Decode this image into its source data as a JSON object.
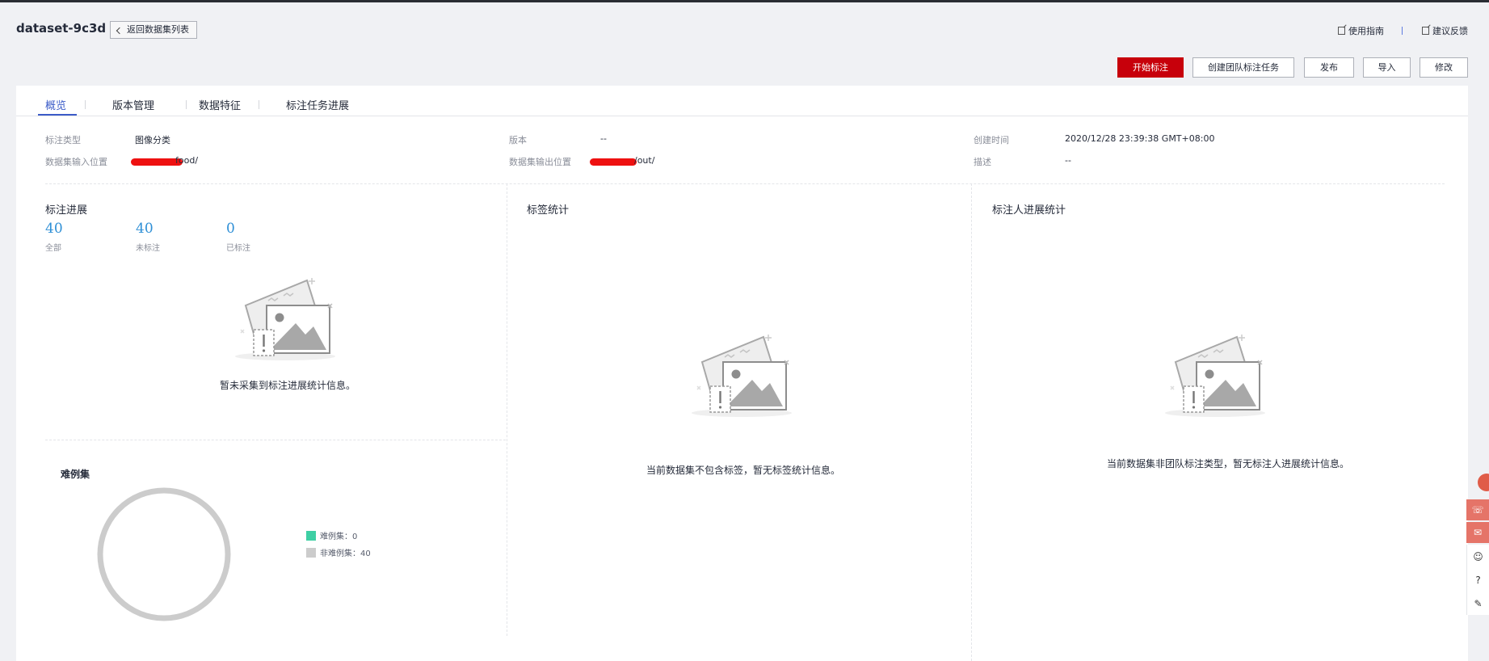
{
  "header": {
    "dataset_name": "dataset-9c3d",
    "back_label": "返回数据集列表",
    "guide_link": "使用指南",
    "feedback_link": "建议反馈"
  },
  "actions": {
    "start_label": "开始标注",
    "team_task_label": "创建团队标注任务",
    "publish_label": "发布",
    "import_label": "导入",
    "modify_label": "修改"
  },
  "tabs": [
    {
      "label": "概览",
      "active": true
    },
    {
      "label": "版本管理",
      "active": false
    },
    {
      "label": "数据特征",
      "active": false
    },
    {
      "label": "标注任务进展",
      "active": false
    }
  ],
  "info": {
    "annotation_type": {
      "label": "标注类型",
      "value": "图像分类"
    },
    "version": {
      "label": "版本",
      "value": "--"
    },
    "created_at": {
      "label": "创建时间",
      "value": "2020/12/28 23:39:38 GMT+08:00"
    },
    "input_location": {
      "label": "数据集输入位置",
      "value": "food/"
    },
    "output_location": {
      "label": "数据集输出位置",
      "value": "/out/"
    },
    "description": {
      "label": "描述",
      "value": "--"
    }
  },
  "progress": {
    "title": "标注进展",
    "stats": [
      {
        "value": "40",
        "label": "全部"
      },
      {
        "value": "40",
        "label": "未标注"
      },
      {
        "value": "0",
        "label": "已标注"
      }
    ],
    "empty_text": "暂未采集到标注进展统计信息。"
  },
  "label_stats": {
    "title": "标签统计",
    "empty_text": "当前数据集不包含标签，暂无标签统计信息。"
  },
  "annotator_stats": {
    "title": "标注人进展统计",
    "empty_text": "当前数据集非团队标注类型，暂无标注人进展统计信息。"
  },
  "difficult": {
    "title": "难例集",
    "legend": [
      {
        "label": "难例集：0",
        "color": "#3ecfa4",
        "count": 0
      },
      {
        "label": "非难例集：40",
        "color": "#cccccc",
        "count": 40
      }
    ]
  },
  "floating_toolbar": [
    "headset-icon",
    "chat-icon",
    "smile-icon",
    "help-icon",
    "checklist-icon"
  ],
  "colors": {
    "primary": "#c7000b",
    "accent": "#3c5cc8",
    "stat_number": "#2e8fd6"
  }
}
